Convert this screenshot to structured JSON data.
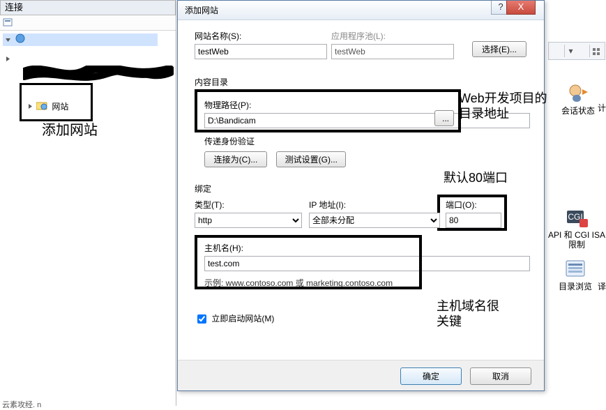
{
  "conn": {
    "title": "连接",
    "sites_label": "网站"
  },
  "left_annotation": "添加网站",
  "dialog": {
    "title": "添加网站",
    "help_glyph": "?",
    "close_glyph": "X",
    "site_name_label": "网站名称(S):",
    "site_name_value": "testWeb",
    "app_pool_label": "应用程序池(L):",
    "app_pool_value": "testWeb",
    "select_btn": "选择(E)...",
    "content_group": "内容目录",
    "phys_label": "物理路径(P):",
    "phys_value": "D:\\Bandicam",
    "browse_btn": "...",
    "passthru_label": "传递身份验证",
    "connect_as_btn": "连接为(C)...",
    "test_btn": "测试设置(G)...",
    "bind_group": "绑定",
    "type_label": "类型(T):",
    "type_value": "http",
    "ip_label": "IP 地址(I):",
    "ip_value": "全部未分配",
    "port_label": "端口(O):",
    "port_value": "80",
    "host_label": "主机名(H):",
    "host_value": "test.com",
    "host_example": "示例: www.contoso.com 或 marketing.contoso.com",
    "start_label": "立即启动网站(M)",
    "ok_btn": "确定",
    "cancel_btn": "取消"
  },
  "annotations": {
    "phys": "Web开发项目的目录地址",
    "port": "默认80端口",
    "host": "主机域名很关键"
  },
  "bg": {
    "session_state": "会话状态",
    "ji": "计",
    "cgi_isapi": "API 和 CGI ISA限制",
    "dir_browse": "目录浏览",
    "yi": "译"
  },
  "status": "云素攻经. n"
}
